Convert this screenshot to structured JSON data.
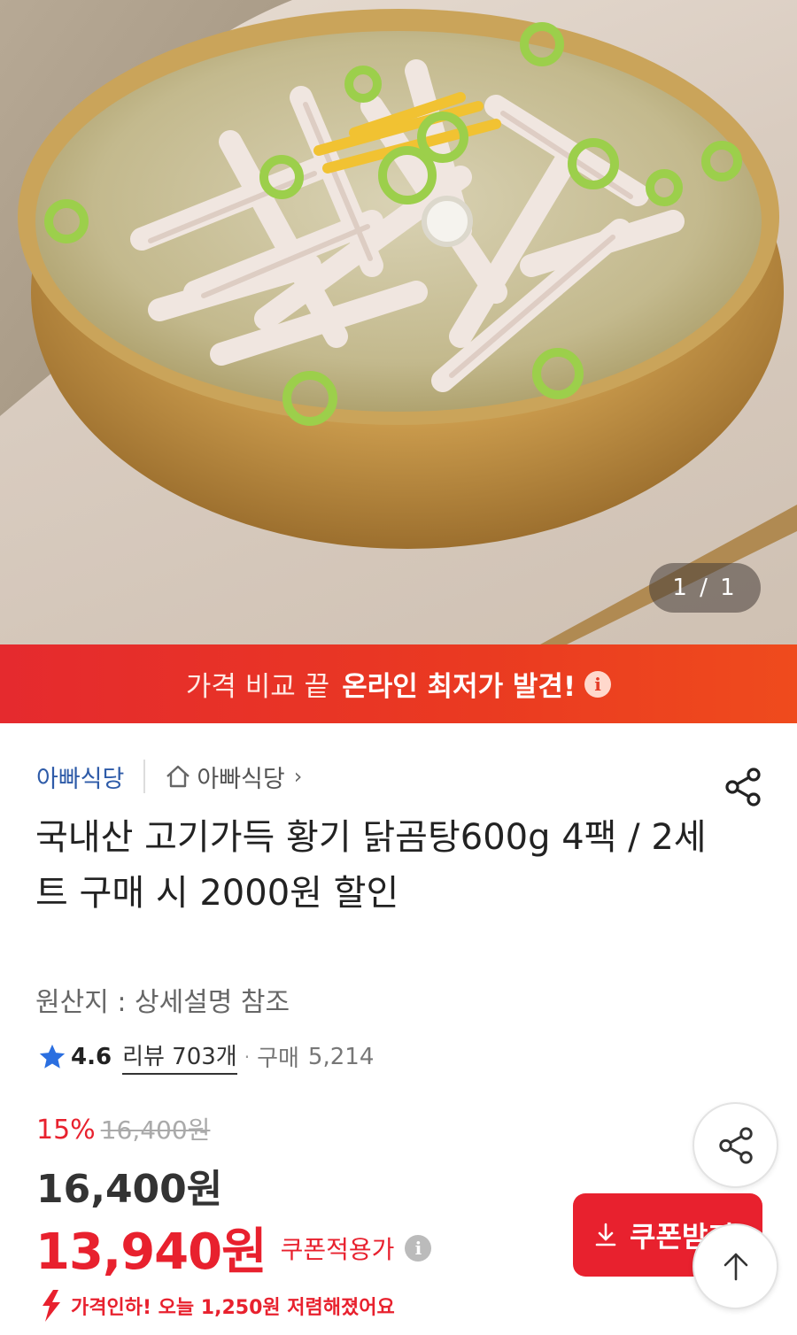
{
  "gallery": {
    "image_alt": "닭곰탕",
    "indicator": "1 / 1"
  },
  "promo": {
    "light_text": "가격 비교 끝",
    "bold_text": "온라인 최저가 발견!",
    "info_icon": "info-icon"
  },
  "product": {
    "brand": "아빠식당",
    "store_link": "아빠식당",
    "title": "국내산 고기가득 황기 닭곰탕600g 4팩 / 2세트 구매 시 2000원 할인",
    "origin": "원산지 : 상세설명 참조",
    "rating": "4.6",
    "review_label": "리뷰 703개",
    "purchase_label": "구매",
    "purchase_count": "5,214"
  },
  "pricing": {
    "discount_rate": "15%",
    "original_price": "16,400원",
    "price": "16,400원",
    "coupon_price": "13,940원",
    "coupon_price_label": "쿠폰적용가",
    "price_drop_notice": "가격인하! 오늘 1,250원 저렴해졌어요"
  },
  "actions": {
    "coupon_button": "쿠폰받기"
  },
  "colors": {
    "accent_red": "#e8212e",
    "brand_blue": "#2e5ba8",
    "banner_red": "#e52a2e"
  }
}
